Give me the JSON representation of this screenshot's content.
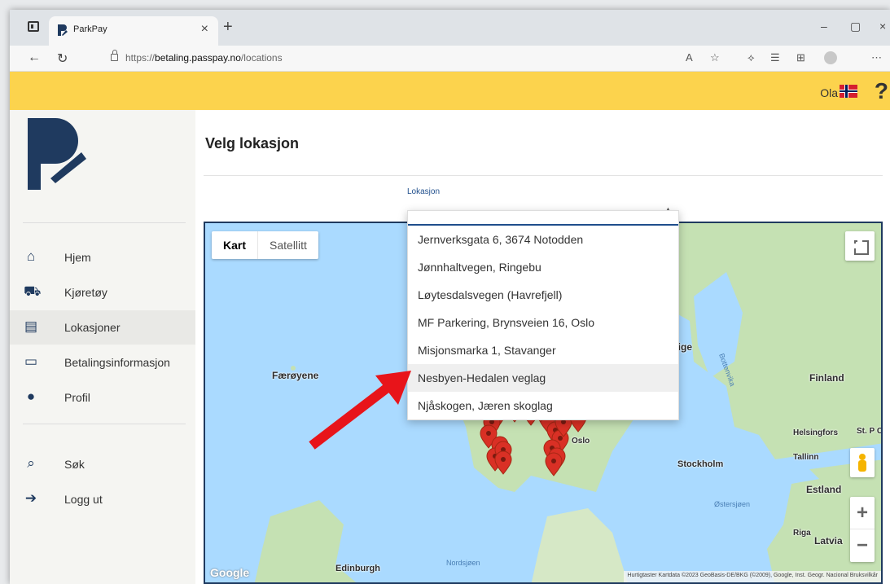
{
  "browser": {
    "tab_title": "ParkPay",
    "tab_close": "×",
    "new_tab": "+",
    "url_prefix": "https://",
    "url_host": "betaling.passpay.no",
    "url_path": "/locations",
    "minimize": "–",
    "maximize": "▢",
    "close": "×"
  },
  "topbar": {
    "user": "Ola",
    "help": "?",
    "accent": "#fcd34d"
  },
  "sidebar": {
    "items": [
      {
        "label": "Hjem",
        "icon": "home-icon"
      },
      {
        "label": "Kjøretøy",
        "icon": "car-icon"
      },
      {
        "label": "Lokasjoner",
        "icon": "list-icon",
        "active": true
      },
      {
        "label": "Betalingsinformasjon",
        "icon": "credit-card-icon"
      },
      {
        "label": "Profil",
        "icon": "user-icon"
      },
      {
        "label": "Søk",
        "icon": "search-icon"
      },
      {
        "label": "Logg ut",
        "icon": "logout-icon"
      }
    ]
  },
  "main": {
    "title": "Velg lokasjon",
    "select_label": "Lokasjon",
    "dropdown_options": [
      "Jernverksgata 6, 3674 Notodden",
      "Jønnhaltvegen, Ringebu",
      "Løytesdalsvegen (Havrefjell)",
      "MF Parkering, Brynsveien 16, Oslo",
      "Misjonsmarka 1, Stavanger",
      "Nesbyen-Hedalen veglag",
      "Njåskogen, Jæren skoglag"
    ],
    "highlighted_option": "Nesbyen-Hedalen veglag"
  },
  "map": {
    "type_map": "Kart",
    "type_satellite": "Satellitt",
    "labels": {
      "faroe": "Færøyene",
      "finland": "Finland",
      "helsinki": "Helsingfors",
      "stpete": "St. P\nСанкт",
      "tallinn": "Tallinn",
      "stockholm": "Stockholm",
      "estland": "Estland",
      "riga": "Riga",
      "latvia": "Latvia",
      "oslo": "Oslo",
      "edinburgh": "Edinburgh",
      "sverige": "rige",
      "nordsjoen": "Nordsjøen",
      "ostersjoen": "Østersjøen",
      "bottenvika": "Bottenvika"
    },
    "zoom_in": "+",
    "zoom_out": "−",
    "google": "Google",
    "attribution": "Hurtigtaster   Kartdata ©2023 GeoBasis-DE/BKG (©2009), Google, Inst. Geogr. Nacional   Bruksvilkår",
    "marker_color": "#d93025"
  }
}
